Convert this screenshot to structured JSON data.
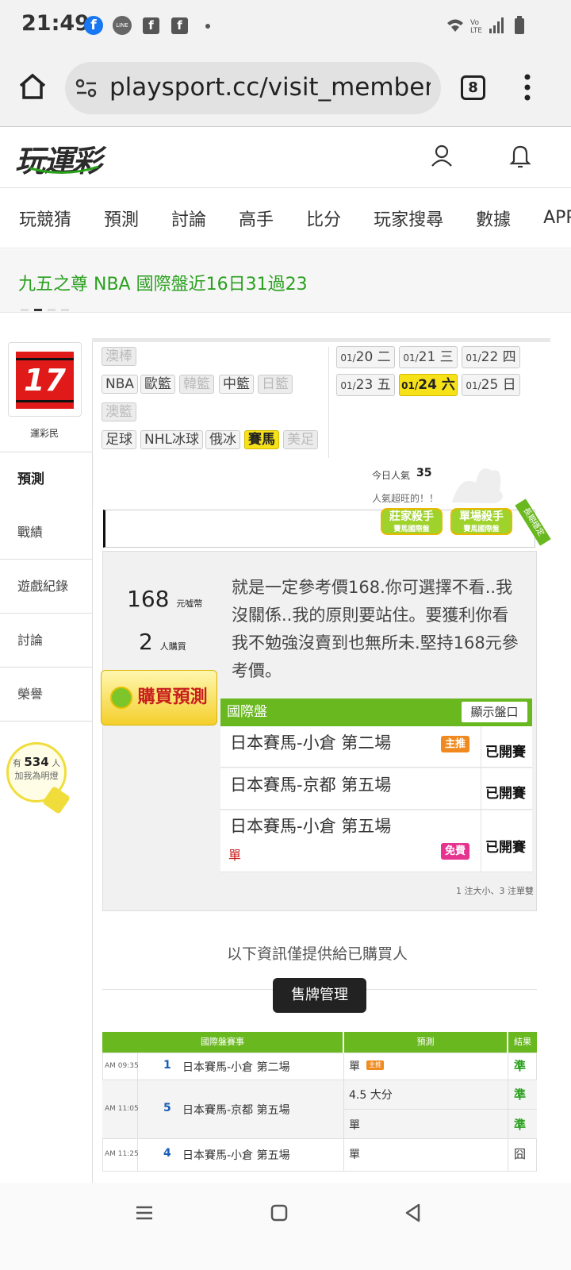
{
  "status": {
    "time": "21:49",
    "tabs": "8"
  },
  "browser": {
    "url": "playsport.cc/visit_member.php"
  },
  "site": {
    "logo": "玩運彩"
  },
  "nav": [
    "玩競猜",
    "預測",
    "討論",
    "高手",
    "比分",
    "玩家搜尋",
    "數據",
    "APP"
  ],
  "banner": "九五之尊 NBA 國際盤近16日31過23",
  "user": {
    "avatar_text": "17",
    "name": "運彩民"
  },
  "sidebar": {
    "active": "預測",
    "items": [
      "戰績",
      "遊戲紀錄",
      "討論",
      "榮譽"
    ]
  },
  "fans": {
    "prefix": "有",
    "count": "534",
    "suffix": "人",
    "sub": "加我為明燈"
  },
  "sports": {
    "row1": [
      "澳棒"
    ],
    "row2": [
      "NBA",
      "歐籃",
      "韓籃",
      "中籃",
      "日籃"
    ],
    "row3": [
      "澳籃"
    ],
    "row4": [
      "足球",
      "NHL冰球",
      "俄冰",
      "賽馬",
      "美足"
    ]
  },
  "dates": [
    {
      "md": "01/",
      "day": "20",
      "wd": "二"
    },
    {
      "md": "01/",
      "day": "21",
      "wd": "三"
    },
    {
      "md": "01/",
      "day": "22",
      "wd": "四"
    },
    {
      "md": "01/",
      "day": "23",
      "wd": "五"
    },
    {
      "md": "01/",
      "day": "24",
      "wd": "六"
    },
    {
      "md": "01/",
      "day": "25",
      "wd": "日"
    }
  ],
  "popularity": {
    "label": "今日人氣",
    "count": "35",
    "sub": "人氣超旺的！！"
  },
  "badges": {
    "b1": "莊家殺手",
    "b1sub": "賽馬國際盤",
    "b2": "單場殺手",
    "b2sub": "賽馬國際盤",
    "ribbon": "長期穩定"
  },
  "prediction": {
    "price": "168",
    "price_unit": "元噓幣",
    "buyers": "2",
    "buyers_unit": "人購買",
    "buy_label": "購買預測",
    "description": "就是一定參考價168.你可選擇不看..我沒關係..我的原則要站住。要獲利你看我不勉強沒賣到也無所未.堅持168元參考價。",
    "table_title": "國際盤",
    "toggle": "顯示盤口",
    "games": [
      {
        "name": "日本賽馬-小倉 第二場",
        "tag": "主推",
        "sub": "",
        "status": "已開賽"
      },
      {
        "name": "日本賽馬-京都 第五場",
        "tag": "",
        "sub": "",
        "status": "已開賽"
      },
      {
        "name": "日本賽馬-小倉 第五場",
        "tag": "免費",
        "sub": "單",
        "status": "已開賽"
      }
    ],
    "note": "1 注大小、3 注單雙"
  },
  "info": "以下資訊僅提供給已購買人",
  "manage_button": "售牌管理",
  "results": {
    "headers": [
      "國際盤賽事",
      "預測",
      "結果"
    ],
    "rows": [
      {
        "time": "AM 09:35",
        "no": "1",
        "game": "日本賽馬-小倉 第二場",
        "pick": "單",
        "tag": "主推",
        "result": "準"
      },
      {
        "time": "AM 11:05",
        "no": "5",
        "game": "日本賽馬-京都 第五場",
        "pick": "4.5 大分",
        "result": "準",
        "pick2": "單",
        "result2": "準"
      },
      {
        "time": "AM 11:25",
        "no": "4",
        "game": "日本賽馬-小倉 第五場",
        "pick": "單",
        "result": "囧"
      }
    ]
  },
  "colors": {
    "green": "#6ab820",
    "yellow": "#f7e21a",
    "brand_green": "#29a31a"
  }
}
